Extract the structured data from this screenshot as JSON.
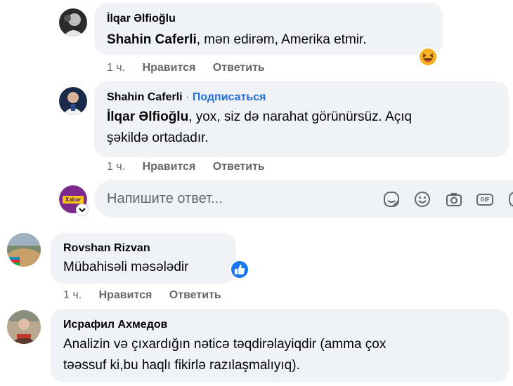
{
  "comments": [
    {
      "author": "İlqar Əlfioğlu",
      "mention": "Shahin Caferli",
      "text": ", mən edirəm, Amerika etmir.",
      "reaction": "laughing-emoji-icon",
      "time": "1 ч.",
      "like": "Нравится",
      "reply": "Ответить"
    },
    {
      "author": "Shahin Caferli",
      "separator": "·",
      "subscribe": "Подписаться",
      "mention": "İlqar Əlfioğlu",
      "text_line1": ", yox, siz də narahat görünürsüz. Açıq",
      "text_line2": "şəkildə ortadadır.",
      "time": "1 ч.",
      "like": "Нравится",
      "reply": "Ответить"
    },
    {
      "author": "Rovshan Rizvan",
      "text": "Mübahisəli məsələdir",
      "reaction": "like-thumb-icon",
      "time": "1 ч.",
      "like": "Нравится",
      "reply": "Ответить"
    },
    {
      "author": "Исрафил Ахмедов",
      "text_line1": "Analizin və çıxardığın nəticə təqdirəlayiqdir (amma çox",
      "text_line2": "təəssuf ki,bu haqlı fikirlə razılaşmalıyıq)."
    }
  ],
  "reply_box": {
    "placeholder": "Напишите ответ...",
    "avatar_label": "Xəbər",
    "tools": [
      "sticker-icon",
      "emoji-icon",
      "camera-icon",
      "gif-icon",
      "sticker-alt-icon"
    ],
    "gif_label": "GIF"
  },
  "colors": {
    "bubble": "#f0f2f5",
    "secondary_text": "#65676b",
    "link_blue": "#216fdb",
    "like_blue": "#1877f2"
  }
}
